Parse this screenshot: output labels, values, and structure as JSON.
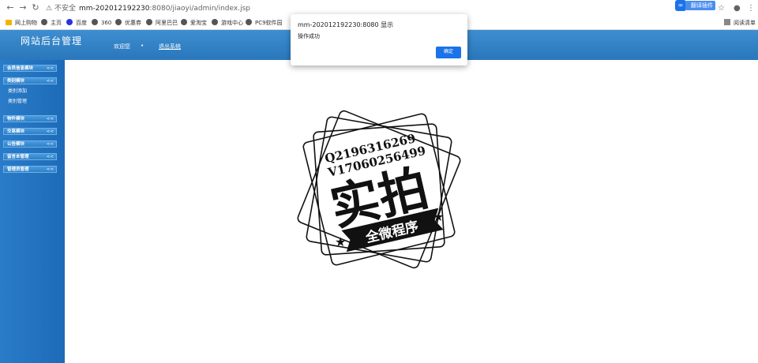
{
  "browser": {
    "security_label": "不安全",
    "url_host": "mm-202012192230",
    "url_path": ":8080/jiaoyi/admin/index.jsp",
    "extension_label": "翻译插件",
    "bookmarks": [
      "网上购物",
      "主页",
      "百度",
      "360",
      "优惠券",
      "阿里巴巴",
      "爱淘宝",
      "游戏中心",
      "PC9软件园"
    ],
    "reading_list": "阅读清单"
  },
  "header": {
    "title": "网站后台管理",
    "welcome": "欢迎您",
    "separator": "•",
    "logout": "退出系统"
  },
  "sidebar": {
    "menus": [
      {
        "label": "会员信息模块",
        "arrow": "<<",
        "subitems": []
      },
      {
        "label": "类别模块",
        "arrow": "<<",
        "subitems": [
          "类别添加",
          "类别管理"
        ]
      },
      {
        "label": "物件模块",
        "arrow": "<<",
        "subitems": []
      },
      {
        "label": "交易模块",
        "arrow": "<<",
        "subitems": []
      },
      {
        "label": "公告模块",
        "arrow": "<<",
        "subitems": []
      },
      {
        "label": "留言本管理",
        "arrow": "<<",
        "subitems": []
      },
      {
        "label": "管理员管理",
        "arrow": "<<",
        "subitems": []
      }
    ]
  },
  "stamp": {
    "line1": "Q2196316269",
    "line2": "V17060256499",
    "main_text": "实拍",
    "banner_text": "全微程序"
  },
  "dialog": {
    "title": "mm-202012192230:8080 显示",
    "message": "操作成功",
    "ok_label": "确定"
  },
  "colors": {
    "header_blue": "#2a77bb",
    "sidebar_blue": "#1d6bb8",
    "dialog_button": "#1a73e8"
  }
}
